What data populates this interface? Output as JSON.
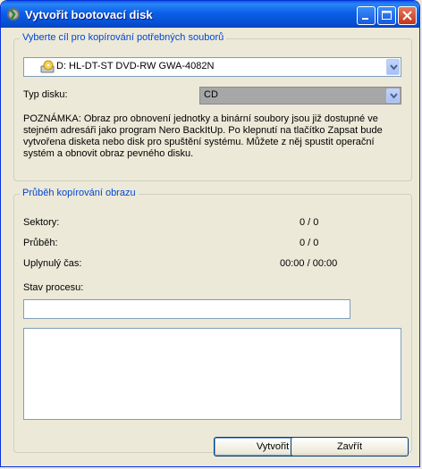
{
  "window": {
    "title": "Vytvořit bootovací disk"
  },
  "target_group": {
    "legend": "Vyberte cíl pro kopírování potřebných souborů",
    "drive_selected": "D: HL-DT-ST DVD-RW GWA-4082N",
    "disk_type_label": "Typ disku:",
    "disk_type_selected": "CD",
    "note": "POZNÁMKA: Obraz pro obnovení jednotky a binární soubory jsou již dostupné ve stejném adresáři jako program Nero BackItUp. Po klepnutí na tlačítko Zapsat bude vytvořena disketa nebo disk pro spuštění systému. Můžete z něj spustit operační systém a obnovit obraz pevného disku."
  },
  "progress_group": {
    "legend": "Průběh kopírování obrazu",
    "sectors_label": "Sektory:",
    "sectors_value": "0 / 0",
    "progress_label": "Průběh:",
    "progress_value": "0 / 0",
    "elapsed_label": "Uplynulý čas:",
    "elapsed_value": "00:00 / 00:00",
    "status_label": "Stav procesu:",
    "status_value": "",
    "log_value": ""
  },
  "buttons": {
    "create": "Vytvořit",
    "close": "Zavřít"
  },
  "colors": {
    "titlebar": "#0a5fe8",
    "group_legend": "#0046d5",
    "window_bg": "#ece9d8"
  }
}
